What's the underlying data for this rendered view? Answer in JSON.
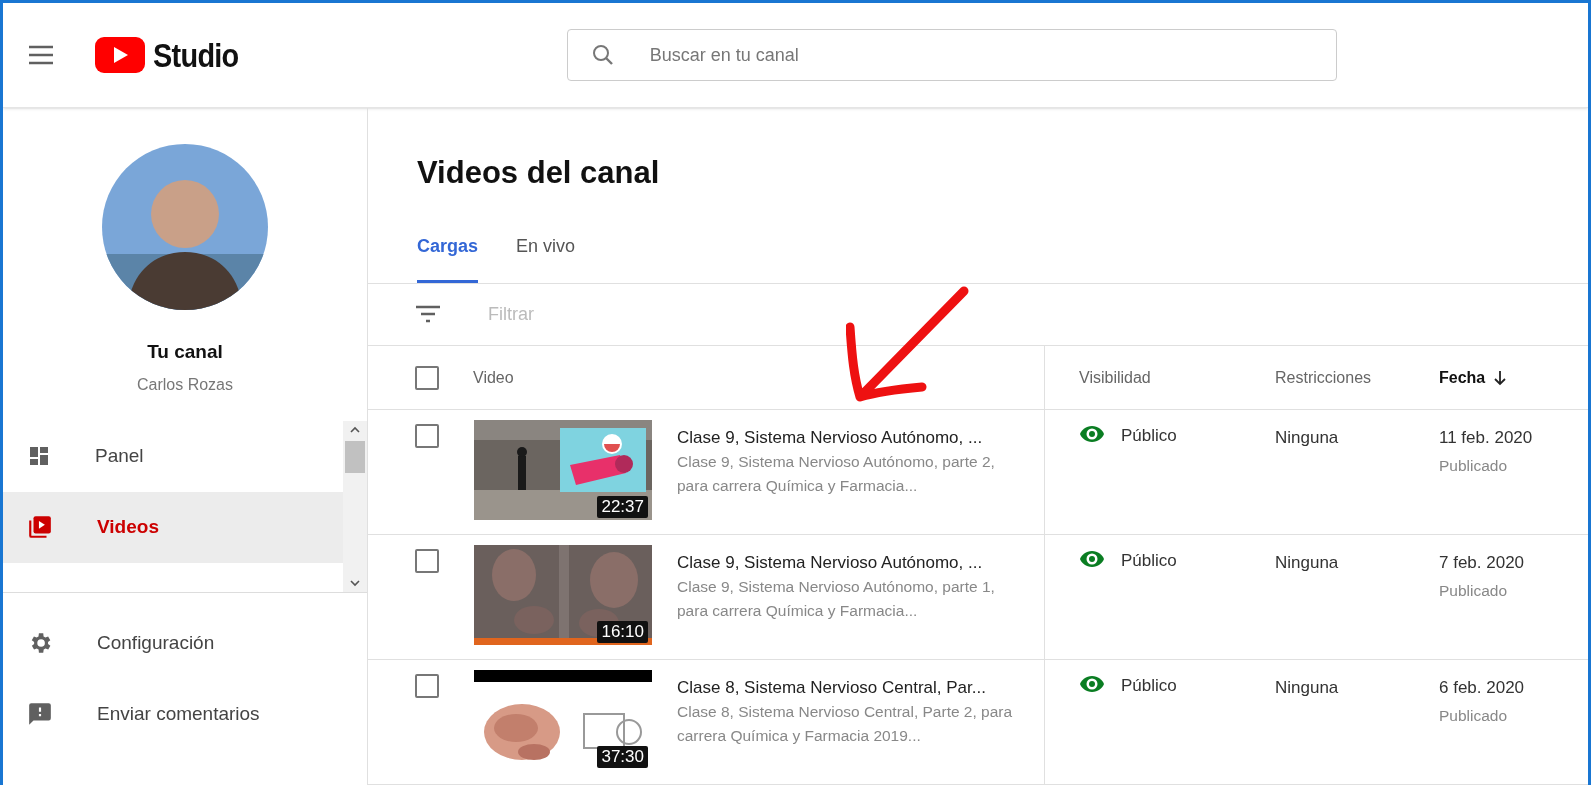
{
  "header": {
    "logo_text": "Studio",
    "search": {
      "placeholder": "Buscar en tu canal"
    }
  },
  "channel": {
    "title": "Tu canal",
    "name": "Carlos Rozas"
  },
  "sidebar": {
    "items": [
      {
        "label": "Panel",
        "kind": "panel",
        "selected": false
      },
      {
        "label": "Videos",
        "kind": "videos",
        "selected": true
      }
    ],
    "footer_items": [
      {
        "label": "Configuración",
        "kind": "settings"
      },
      {
        "label": "Enviar comentarios",
        "kind": "feedback"
      }
    ]
  },
  "page_title": "Videos del canal",
  "tabs": [
    {
      "label": "Cargas",
      "selected": true
    },
    {
      "label": "En vivo",
      "selected": false
    }
  ],
  "filter": {
    "placeholder": "Filtrar"
  },
  "table": {
    "select_all_checked": false,
    "columns": [
      "Video",
      "Visibilidad",
      "Restricciones",
      "Fecha"
    ],
    "rows": [
      {
        "checked": false,
        "duration": "22:37",
        "title": "Clase 9, Sistema Nervioso Autónomo, ...",
        "description": "Clase 9, Sistema Nervioso Autónomo, parte 2, para carrera Química y Farmacia...",
        "visibility": "Público",
        "restrictions": "Ninguna",
        "date": "11 feb. 2020",
        "status": "Publicado"
      },
      {
        "checked": false,
        "duration": "16:10",
        "title": "Clase 9, Sistema Nervioso Autónomo, ...",
        "description": "Clase 9, Sistema Nervioso Autónomo, parte 1, para carrera Química y Farmacia...",
        "visibility": "Público",
        "restrictions": "Ninguna",
        "date": "7 feb. 2020",
        "status": "Publicado"
      },
      {
        "checked": false,
        "duration": "37:30",
        "title": "Clase 8, Sistema Nervioso Central, Par...",
        "description": "Clase 8, Sistema Nervioso Central, Parte 2, para carrera Química y Farmacia 2019...",
        "visibility": "Público",
        "restrictions": "Ninguna",
        "date": "6 feb. 2020",
        "status": "Publicado"
      }
    ]
  }
}
